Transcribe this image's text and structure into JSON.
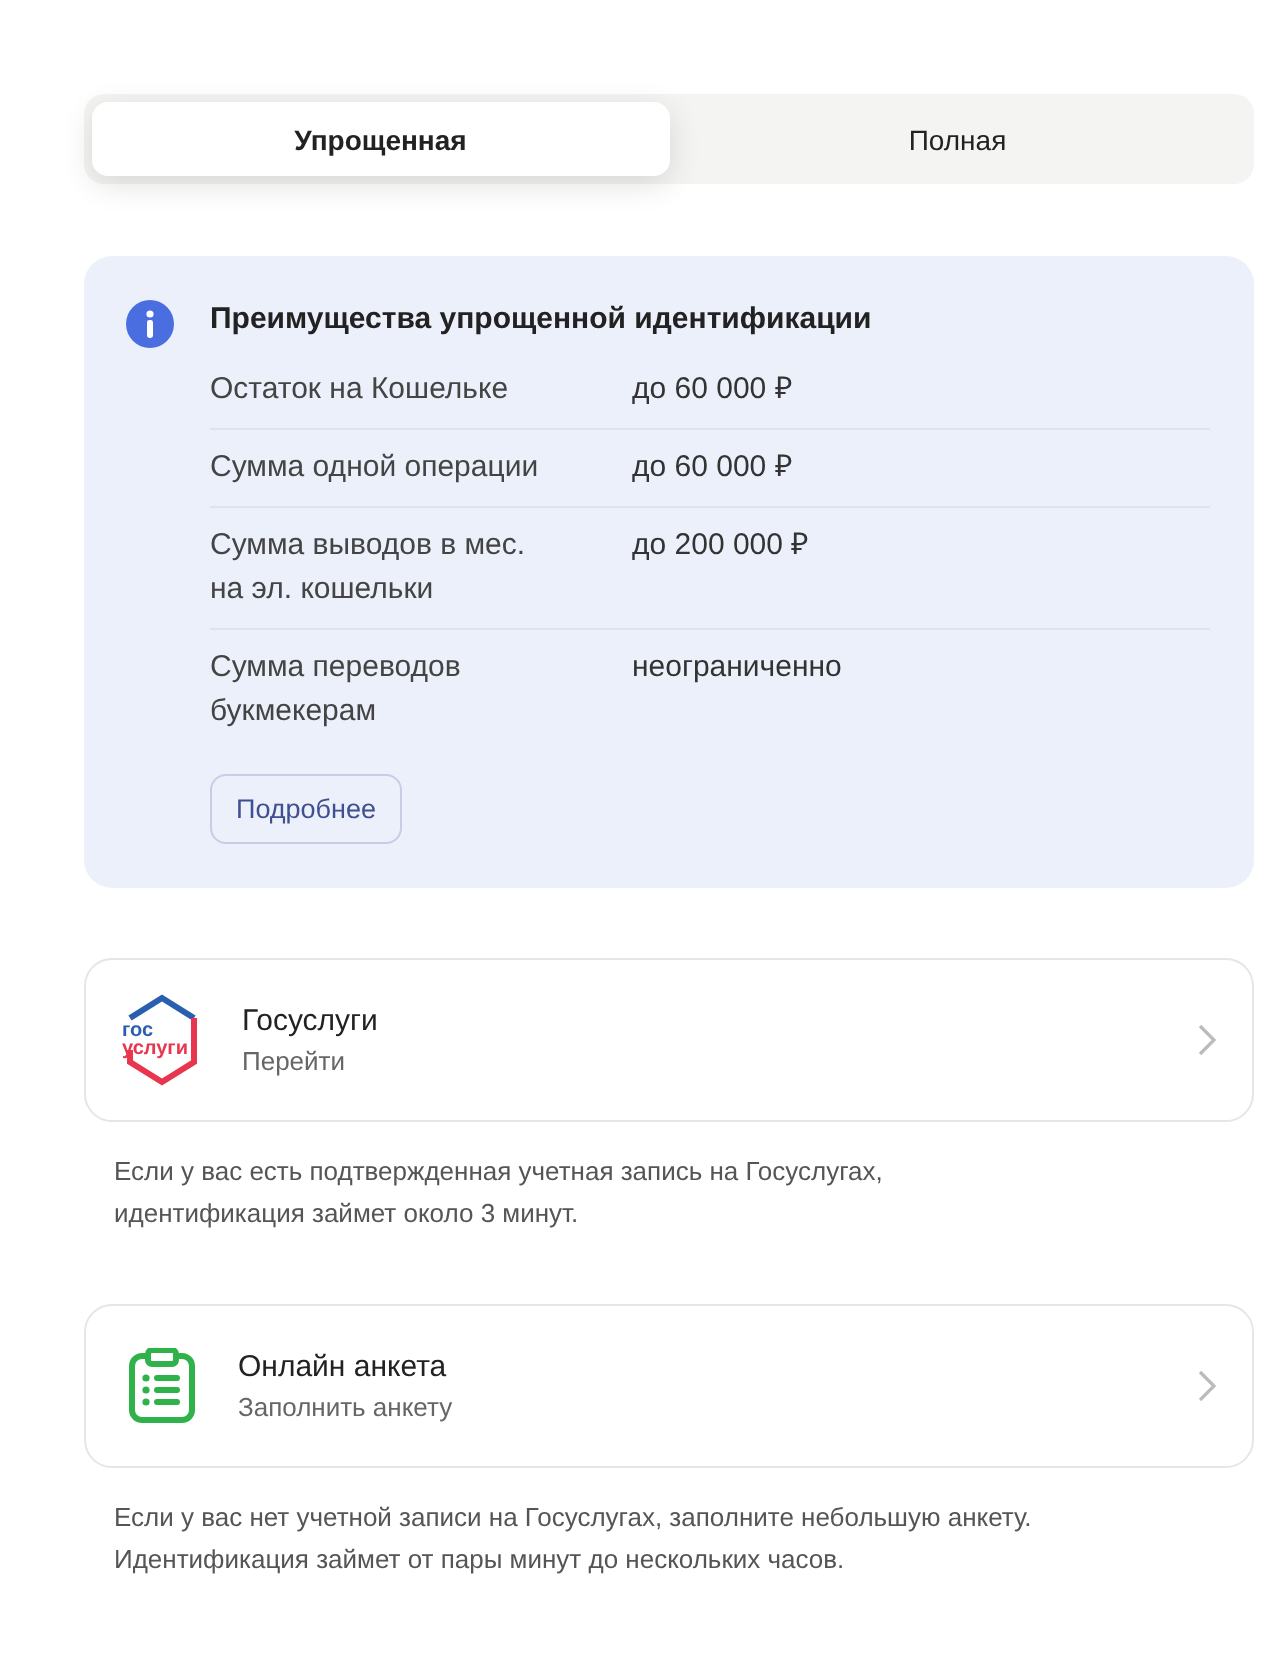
{
  "tabs": [
    {
      "label": "Упрощенная",
      "selected": true
    },
    {
      "label": "Полная",
      "selected": false
    }
  ],
  "info": {
    "title": "Преимущества упрощенной идентификации",
    "rows": [
      {
        "label": "Остаток на Кошельке",
        "value": "до 60 000 ₽"
      },
      {
        "label": "Сумма одной операции",
        "value": "до 60 000 ₽"
      },
      {
        "label": "Сумма выводов в мес.\nна эл. кошельки",
        "value": "до 200 000 ₽"
      },
      {
        "label": "Сумма переводов\nбукмекерам",
        "value": "неограниченно"
      }
    ],
    "button": "Подробнее"
  },
  "options": [
    {
      "kind": "gosuslugi",
      "logo": [
        "гос",
        "услуги"
      ],
      "title": "Госуслуги",
      "subtitle": "Перейти",
      "note": "Если у вас есть подтвержденная учетная запись на Госуслугах,\nидентификация займет около 3 минут."
    },
    {
      "kind": "form",
      "title": "Онлайн анкета",
      "subtitle": "Заполнить анкету",
      "note": "Если у вас нет учетной записи на Госуслугах, заполните небольшую анкету.\nИдентификация займет от пары минут до нескольких часов."
    }
  ]
}
